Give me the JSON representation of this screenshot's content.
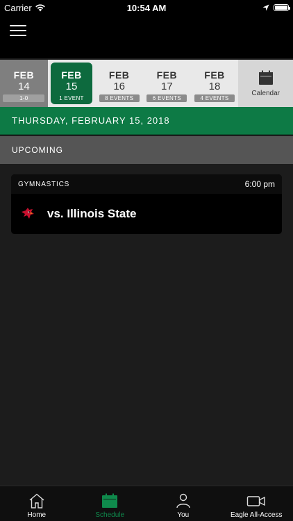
{
  "status_bar": {
    "carrier": "Carrier",
    "time": "10:54 AM",
    "battery_level": 1.0
  },
  "nav": {
    "menu_icon": "hamburger-icon"
  },
  "date_strip": {
    "days": [
      {
        "month": "FEB",
        "day": "14",
        "badge": "1-0",
        "state": "past"
      },
      {
        "month": "FEB",
        "day": "15",
        "badge": "1 EVENT",
        "state": "selected"
      },
      {
        "month": "FEB",
        "day": "16",
        "badge": "8 EVENTS",
        "state": "upcoming"
      },
      {
        "month": "FEB",
        "day": "17",
        "badge": "6 EVENTS",
        "state": "upcoming"
      },
      {
        "month": "FEB",
        "day": "18",
        "badge": "4 EVENTS",
        "state": "upcoming"
      }
    ],
    "calendar_label": "Calendar"
  },
  "date_header": "THURSDAY, FEBRUARY 15, 2018",
  "section_header": "UPCOMING",
  "event": {
    "sport": "GYMNASTICS",
    "time": "6:00 pm",
    "opponent": "vs. Illinois State",
    "logo_icon": "redbird-logo-icon"
  },
  "tab_bar": {
    "tabs": [
      {
        "label": "Home",
        "icon": "home-icon"
      },
      {
        "label": "Schedule",
        "icon": "calendar-icon",
        "active": true
      },
      {
        "label": "You",
        "icon": "person-icon"
      },
      {
        "label": "Eagle All-Access",
        "icon": "video-camera-icon"
      }
    ]
  },
  "colors": {
    "accent_green": "#0d7a45",
    "selected_green": "#0d6a3e",
    "active_tab": "#0f8a4c"
  }
}
